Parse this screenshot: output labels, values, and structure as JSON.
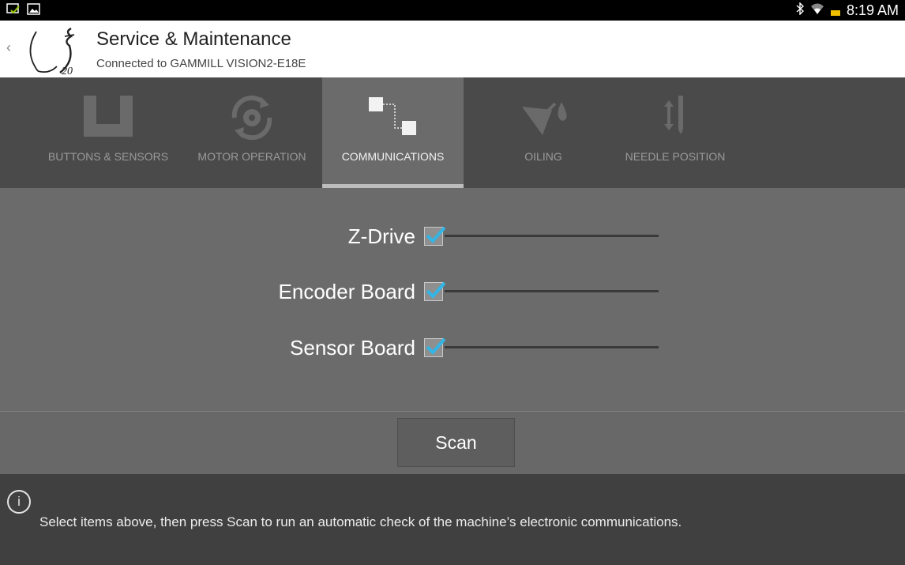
{
  "status_bar": {
    "time": "8:19 AM",
    "icons": [
      "notification-check-icon",
      "image-icon",
      "bluetooth-icon",
      "wifi-icon",
      "battery-icon"
    ]
  },
  "app_bar": {
    "title": "Service & Maintenance",
    "subtitle": "Connected to GAMMILL VISION2-E18E",
    "logo_text": "20"
  },
  "tabs": [
    {
      "label": "BUTTONS & SENSORS",
      "icon": "buttons-sensors-icon",
      "active": false
    },
    {
      "label": "MOTOR OPERATION",
      "icon": "motor-gear-icon",
      "active": false
    },
    {
      "label": "COMMUNICATIONS",
      "icon": "communications-icon",
      "active": true
    },
    {
      "label": "OILING",
      "icon": "oil-can-icon",
      "active": false
    },
    {
      "label": "NEEDLE POSITION",
      "icon": "needle-icon",
      "active": false
    }
  ],
  "communications": {
    "items": [
      {
        "label": "Z-Drive",
        "checked": true
      },
      {
        "label": "Encoder Board",
        "checked": true
      },
      {
        "label": "Sensor Board",
        "checked": true
      }
    ]
  },
  "scan_button": {
    "label": "Scan"
  },
  "info": {
    "text": "Select items above, then press Scan to run an automatic check of the machine’s electronic communications."
  },
  "colors": {
    "check_accent": "#33b5e5",
    "tab_bar": "#4a4a4a",
    "panel": "#6b6b6b",
    "info_bar": "#404040"
  }
}
